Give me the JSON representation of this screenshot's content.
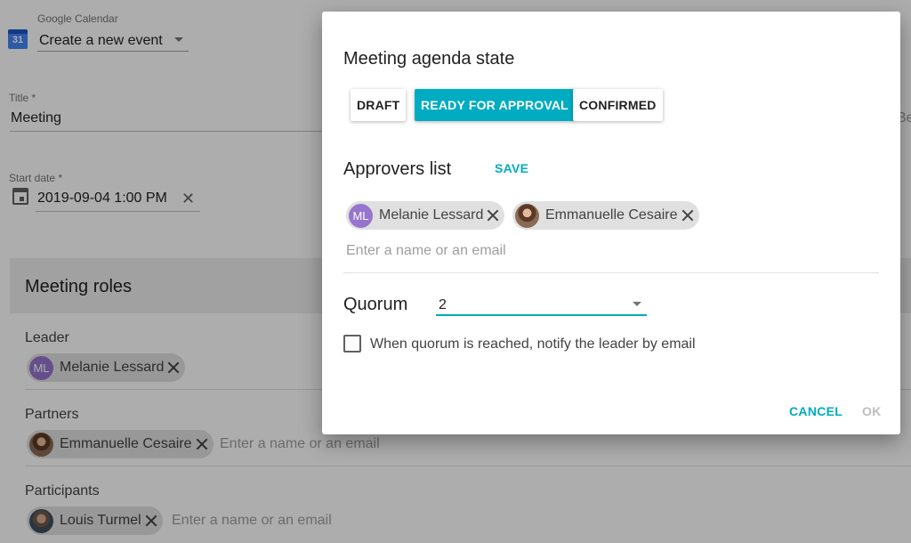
{
  "app": {
    "name": "Google Calendar",
    "calendar_icon_day": "31",
    "action": "Create a new event",
    "icon": "google-calendar-icon"
  },
  "form": {
    "title_label": "Title *",
    "title_value": "Meeting",
    "right_cutoff_text": "Be",
    "start_date_label": "Start date *",
    "start_date_value": "2019-09-04 1:00 PM",
    "clear_glyph": "✕"
  },
  "roles": {
    "heading": "Meeting roles",
    "leader": {
      "label": "Leader",
      "chips": [
        {
          "name": "Melanie Lessard",
          "initials": "ML"
        }
      ]
    },
    "partners": {
      "label": "Partners",
      "chips": [
        {
          "name": "Emmanuelle Cesaire"
        }
      ],
      "placeholder": "Enter a name or an email"
    },
    "participants": {
      "label": "Participants",
      "chips": [
        {
          "name": "Louis Turmel"
        }
      ],
      "placeholder": "Enter a name or an email"
    }
  },
  "dialog": {
    "title": "Meeting agenda state",
    "states": [
      {
        "label": "DRAFT",
        "active": false
      },
      {
        "label": "READY FOR APPROVAL",
        "active": true
      },
      {
        "label": "CONFIRMED",
        "active": false
      }
    ],
    "approvers_title": "Approvers list",
    "save_label": "SAVE",
    "approvers": [
      {
        "name": "Melanie Lessard",
        "initials": "ML"
      },
      {
        "name": "Emmanuelle Cesaire"
      }
    ],
    "approver_placeholder": "Enter a name or an email",
    "quorum_label": "Quorum",
    "quorum_value": "2",
    "notify_label": "When quorum is reached, notify the leader by email",
    "notify_checked": false,
    "cancel_label": "CANCEL",
    "ok_label": "OK"
  },
  "colors": {
    "accent": "#00acc1",
    "disabled": "#bdbdbd",
    "chip_bg": "#e0e0e0",
    "avatar_initials_bg": "#9575cd"
  }
}
